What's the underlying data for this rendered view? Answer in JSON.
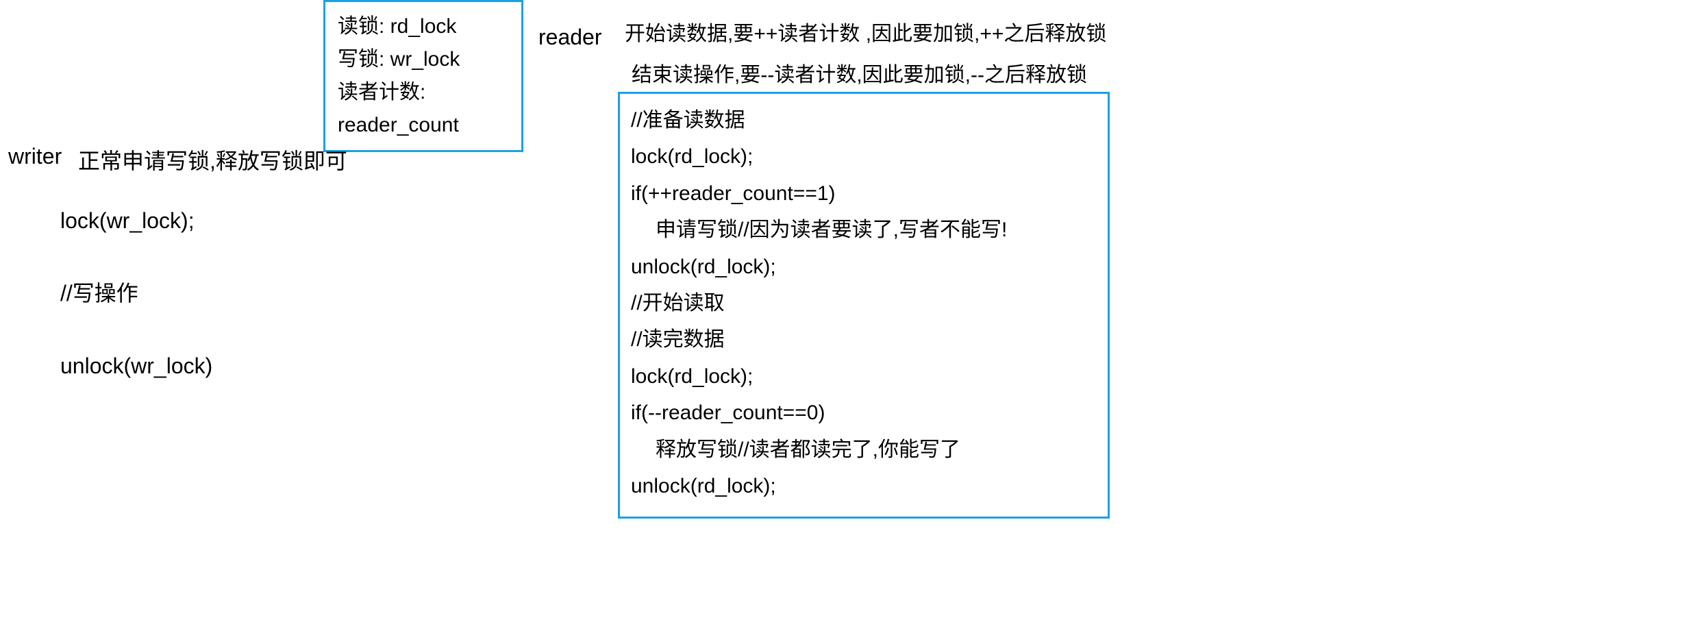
{
  "definitions": {
    "line1": "读锁:  rd_lock",
    "line2": "写锁:  wr_lock",
    "line3": "读者计数: reader_count"
  },
  "reader_label": "reader",
  "reader_desc_1": "开始读数据,要++读者计数 ,因此要加锁,++之后释放锁",
  "reader_desc_2": "结束读操作,要--读者计数,因此要加锁,--之后释放锁",
  "writer_label": "writer",
  "writer_desc": "正常申请写锁,释放写锁即可",
  "writer_code": {
    "line1": "lock(wr_lock);",
    "line2": "//写操作",
    "line3": "unlock(wr_lock)"
  },
  "reader_code": {
    "l1": "//准备读数据",
    "l2": "lock(rd_lock);",
    "l3": "if(++reader_count==1)",
    "l4": "申请写锁//因为读者要读了,写者不能写!",
    "l5": "unlock(rd_lock);",
    "l6": "//开始读取",
    "l7": "//读完数据",
    "l8": "lock(rd_lock);",
    "l9": "if(--reader_count==0)",
    "l10": "释放写锁//读者都读完了,你能写了",
    "l11": "unlock(rd_lock);"
  }
}
